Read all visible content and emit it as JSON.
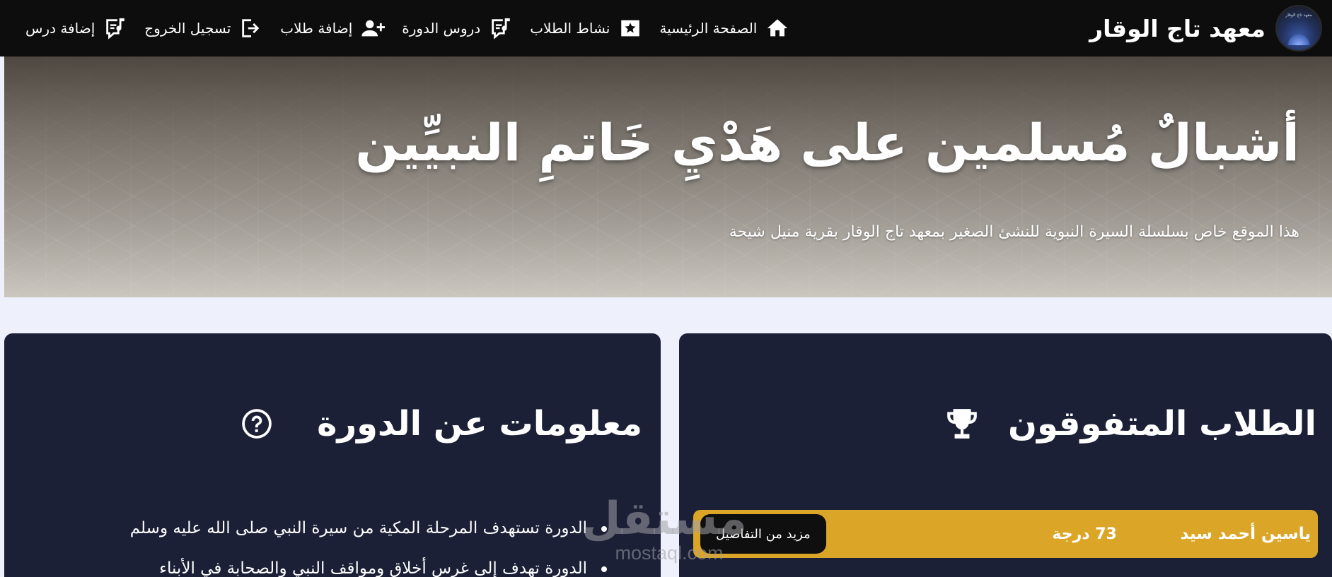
{
  "brand": {
    "name": "معهد تاج الوقار",
    "logo_text": "معهد تاج الوقار"
  },
  "nav": {
    "items": [
      {
        "label": "الصفحة الرئيسية",
        "icon": "home-icon"
      },
      {
        "label": "نشاط الطلاب",
        "icon": "star-badge-icon"
      },
      {
        "label": "دروس الدورة",
        "icon": "lessons-icon"
      },
      {
        "label": "إضافة طلاب",
        "icon": "add-user-icon"
      },
      {
        "label": "تسجيل الخروج",
        "icon": "logout-icon"
      },
      {
        "label": "إضافة درس",
        "icon": "add-lesson-icon"
      }
    ]
  },
  "hero": {
    "title": "أشبالٌ مُسلمين على هَدْيِ خَاتمِ النبيِّين",
    "subtitle": "هذا الموقع خاص بسلسلة السيرة النبوية للنشئ الصغير بمعهد تاج الوقار بقرية منيل شيحة"
  },
  "top_students": {
    "title": "الطلاب المتفوقون",
    "icon": "trophy-icon",
    "students": [
      {
        "name": "ياسين أحمد سيد",
        "score": "73 درجة",
        "details_label": "مزيد من التفاصيل"
      }
    ]
  },
  "course_info": {
    "title": "معلومات عن الدورة",
    "icon": "question-circle-icon",
    "items": [
      "الدورة تستهدف المرحلة المكية من سيرة النبي صلى الله عليه وسلم",
      "الدورة تهدف إلى غرس أخلاق ومواقف النبي والصحابة في الأبناء"
    ]
  },
  "watermark": {
    "arabic": "مستقل",
    "latin": "mostaql.com"
  },
  "colors": {
    "navbar": "#0d0d0d",
    "card": "#1b2037",
    "student_row": "#dba628",
    "page_bg": "#eef1fb"
  }
}
